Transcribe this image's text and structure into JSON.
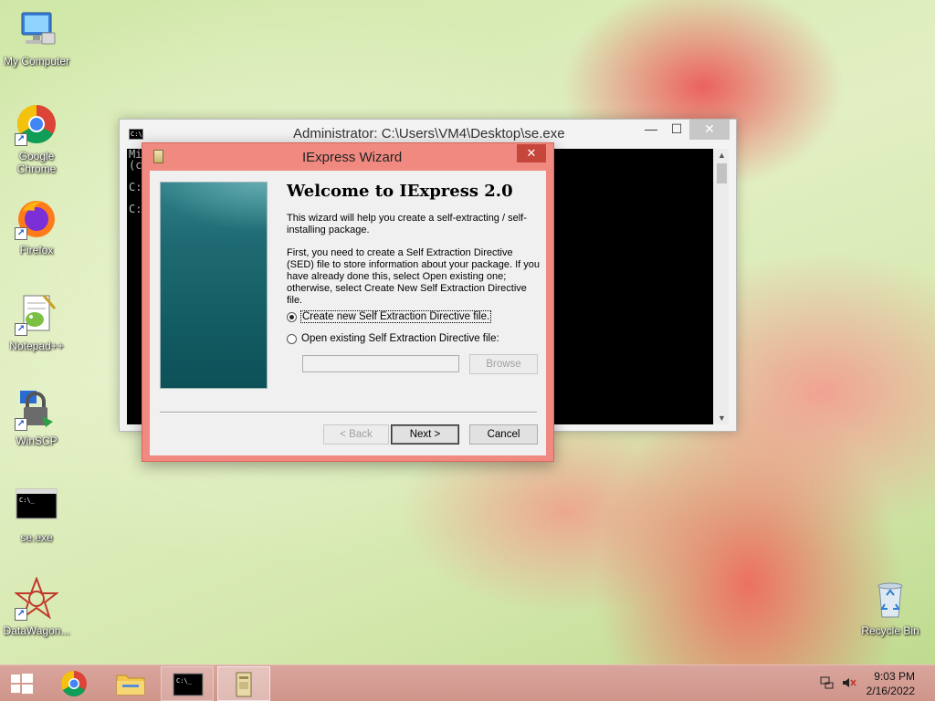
{
  "desktop": {
    "icons": [
      {
        "label": "My Computer"
      },
      {
        "label": "Google Chrome"
      },
      {
        "label": "Firefox"
      },
      {
        "label": "Notepad++"
      },
      {
        "label": "WinSCP"
      },
      {
        "label": "se.exe"
      },
      {
        "label": "DataWagon..."
      },
      {
        "label": "Recycle Bin"
      }
    ]
  },
  "console": {
    "title": "Administrator: C:\\Users\\VM4\\Desktop\\se.exe",
    "lines": [
      "Mi",
      "(c",
      "",
      "C:",
      "",
      "C:"
    ],
    "minimize": "—",
    "maximize": "☐",
    "close": "✕"
  },
  "wizard": {
    "title": "IExpress Wizard",
    "close": "✕",
    "heading": "Welcome to IExpress 2.0",
    "intro": "This wizard will help you create a self-extracting / self-installing package.",
    "instructions": "First, you need to create a Self Extraction Directive (SED) file to store information about your package.  If you have already done this, select Open existing one; otherwise, select Create New Self Extraction Directive file.",
    "option_create": "Create new Self Extraction Directive file.",
    "option_open": "Open existing Self Extraction Directive file:",
    "path_value": "",
    "browse_label": "Browse",
    "back_label": "< Back",
    "next_label": "Next >",
    "cancel_label": "Cancel",
    "selected_option": "create"
  },
  "taskbar": {
    "time": "9:03 PM",
    "date": "2/16/2022"
  }
}
